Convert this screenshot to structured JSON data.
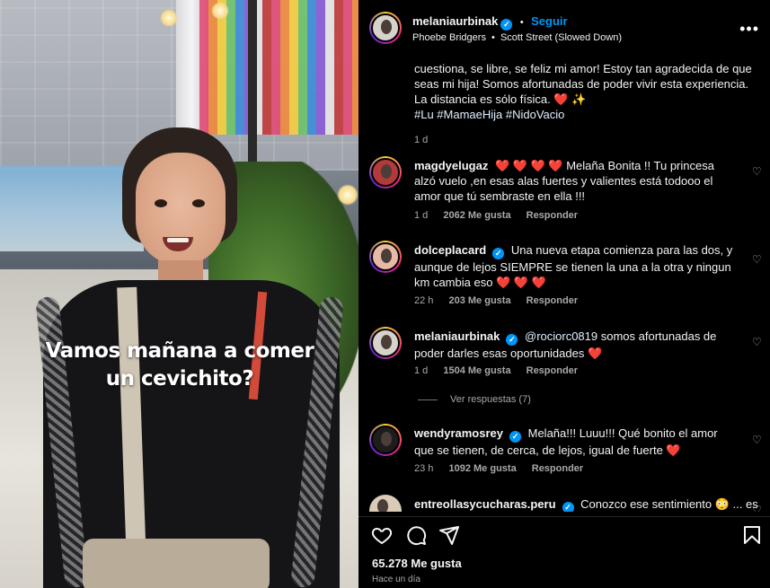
{
  "post": {
    "caption_overlay": "Vamos mañana a comer un cevichito?"
  },
  "header": {
    "username": "melaniaurbinak",
    "follow_label": "Seguir",
    "separator": "•",
    "music_artist": "Phoebe Bridgers",
    "music_track": "Scott Street (Slowed Down)",
    "more_label": "•••"
  },
  "caption": {
    "text": "cuestiona, se libre, se feliz mi amor! Estoy tan agradecida de que seas mi hija! Somos afortunadas de poder vivir esta experiencia. La distancia es sólo física. ❤️ ✨",
    "hashtags": "#Lu #MamaeHija #NidoVacio",
    "time": "1 d"
  },
  "comments": [
    {
      "username": "magdyelugaz",
      "verified": false,
      "prefix": "❤️ ❤️ ❤️ ❤️",
      "text": "Melaña Bonita !! Tu princesa alzó vuelo ,en esas alas fuertes y valientes está todooo el amor que tú sembraste en ella !!!",
      "time": "1 d",
      "likes": "2062 Me gusta",
      "reply": "Responder",
      "avatar_color": "#b23a3a"
    },
    {
      "username": "dolceplacard",
      "verified": true,
      "prefix": "",
      "text": "Una nueva etapa comienza para las dos, y aunque de lejos SIEMPRE se tienen la una a la otra y ningun km cambia eso ❤️ ❤️ ❤️",
      "time": "22 h",
      "likes": "203 Me gusta",
      "reply": "Responder",
      "avatar_color": "#e9b9a7"
    },
    {
      "username": "melaniaurbinak",
      "verified": true,
      "mention": "@rociorc0819",
      "text": "somos afortunadas de poder darles esas oportunidades ❤️",
      "time": "1 d",
      "likes": "1504 Me gusta",
      "reply": "Responder",
      "avatar_color": "#d7d2cb"
    },
    {
      "username": "wendyramosrey",
      "verified": true,
      "prefix": "",
      "text": "Melaña!!! Luuu!!! Qué bonito el amor que se tienen, de cerca, de lejos, igual de fuerte ❤️",
      "time": "23 h",
      "likes": "1092 Me gusta",
      "reply": "Responder",
      "avatar_color": "#1d1d1d"
    },
    {
      "username": "entreollasycucharas.peru",
      "verified": true,
      "prefix": "",
      "text": "Conozco ese sentimiento 😳 ... es",
      "avatar_color": "#d9cbb8"
    }
  ],
  "view_replies": "Ver respuestas (7)",
  "footer": {
    "likes": "65.278 Me gusta",
    "time_ago": "Hace un día"
  },
  "icons": {
    "like": "heart-icon",
    "comment": "comment-icon",
    "share": "share-icon",
    "save": "bookmark-icon",
    "more": "more-options-icon",
    "verified": "verified-badge-icon",
    "comment_like": "heart-outline-icon"
  },
  "colors": {
    "background": "#000000",
    "accent_blue": "#0095f6",
    "secondary_text": "#a8a8a8",
    "heart_red": "#ff3040"
  }
}
